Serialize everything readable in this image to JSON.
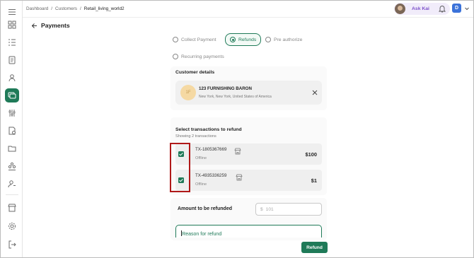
{
  "breadcrumb": [
    "Dashboard",
    "Customers",
    "Retail_living_world2"
  ],
  "header": {
    "ask_label": "Ask Kai",
    "user_initial": "D"
  },
  "page": {
    "title": "Payments"
  },
  "payment_types": [
    {
      "label": "Collect Payment",
      "selected": false
    },
    {
      "label": "Refunds",
      "selected": true
    },
    {
      "label": "Pre authorize",
      "selected": false
    },
    {
      "label": "Recurring payments",
      "selected": false
    }
  ],
  "customer": {
    "section_title": "Customer details",
    "initials": "1F",
    "name": "123 FURNISHING BARON",
    "address": "New York, New York, United States of America"
  },
  "transactions": {
    "section_title": "Select transactions to refund",
    "subtitle": "Showing 2 transactions",
    "rows": [
      {
        "id": "TX-1805367669",
        "status": "Offline",
        "amount": "$100",
        "checked": true
      },
      {
        "id": "TX-4935336259",
        "status": "Offline",
        "amount": "$1",
        "checked": true
      }
    ]
  },
  "refund_form": {
    "amount_label": "Amount to be refunded",
    "currency_symbol": "$",
    "amount_placeholder": "101",
    "reason_placeholder": "Reason for refund",
    "submit_label": "Refund"
  },
  "colors": {
    "accent": "#1f7a58",
    "ask_text": "#7b4fc9",
    "avatar_bg": "#3b72d9",
    "highlight": "#b01919"
  },
  "icons": {
    "sidebar": [
      "menu-icon",
      "dashboard-icon",
      "list-icon",
      "document-icon",
      "user-icon",
      "payments-icon",
      "sliders-icon",
      "invoice-icon",
      "folder-icon",
      "team-icon",
      "contact-icon",
      "store-icon",
      "settings-icon",
      "logout-icon"
    ]
  }
}
